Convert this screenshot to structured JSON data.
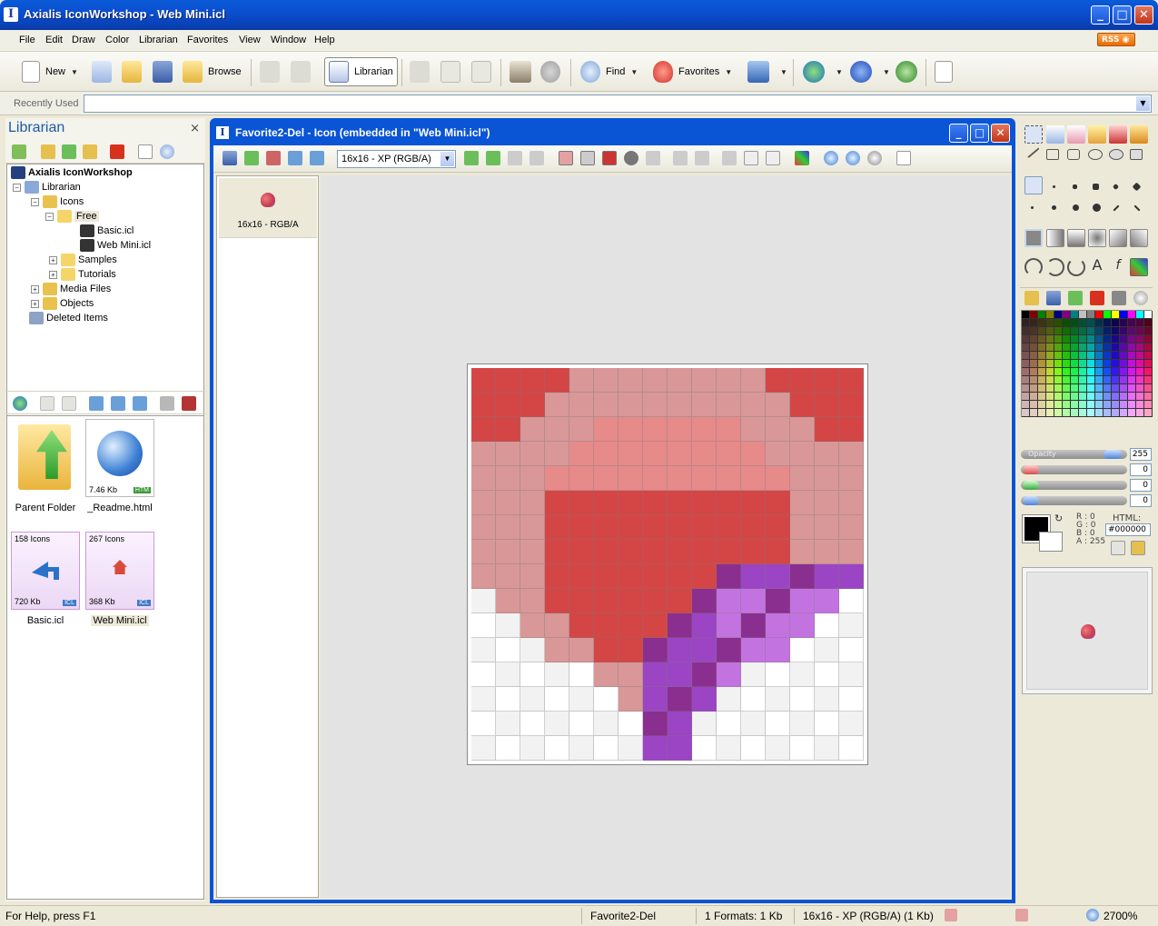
{
  "window": {
    "title": "Axialis IconWorkshop - Web Mini.icl",
    "minimize": "_",
    "maximize": "□",
    "close": "✕"
  },
  "menu": [
    "File",
    "Edit",
    "Draw",
    "Color",
    "Librarian",
    "Favorites",
    "View",
    "Window",
    "Help"
  ],
  "rss_label": "RSS",
  "toolbar": {
    "new_label": "New",
    "browse_label": "Browse",
    "librarian_label": "Librarian",
    "find_label": "Find",
    "favorites_label": "Favorites"
  },
  "recent": {
    "label": "Recently Used",
    "value": ""
  },
  "librarian": {
    "title": "Librarian",
    "close": "×",
    "tree": [
      {
        "label": "Axialis IconWorkshop",
        "level": 0
      },
      {
        "label": "Librarian",
        "level": 1
      },
      {
        "label": "Icons",
        "level": 2
      },
      {
        "label": "Free",
        "level": 3
      },
      {
        "label": "Basic.icl",
        "level": 4
      },
      {
        "label": "Web Mini.icl",
        "level": 4
      },
      {
        "label": "Samples",
        "level": 3
      },
      {
        "label": "Tutorials",
        "level": 3
      },
      {
        "label": "Media Files",
        "level": 2
      },
      {
        "label": "Objects",
        "level": 2
      },
      {
        "label": "Deleted Items",
        "level": 1
      }
    ],
    "files": [
      {
        "name": "Parent Folder"
      },
      {
        "name": "_Readme.html",
        "size": "7.46 Kb",
        "tag": "HTM"
      },
      {
        "name": "Basic.icl",
        "count": "158 Icons",
        "size": "720 Kb",
        "tag": "ICL"
      },
      {
        "name": "Web Mini.icl",
        "count": "267 Icons",
        "size": "368 Kb",
        "tag": "ICL"
      }
    ]
  },
  "document": {
    "title": "Favorite2-Del - Icon (embedded in \"Web Mini.icl\")",
    "format_select": "16x16 - XP (RGB/A)",
    "format_entry": "16x16 - RGB/A"
  },
  "colors": {
    "opacity_label": "Opacity",
    "opacity": "255",
    "r_val": "0",
    "g_val": "0",
    "b_val": "0",
    "rgba_r": "R : 0",
    "rgba_g": "G : 0",
    "rgba_b": "B : 0",
    "rgba_a": "A : 255",
    "html_label": "HTML:",
    "html_value": "#000000",
    "current": "#000000"
  },
  "status": {
    "help": "For Help, press F1",
    "name": "Favorite2-Del",
    "formats": "1 Formats: 1 Kb",
    "size": "16x16 - XP (RGB/A) (1 Kb)",
    "zoom": "2700%"
  }
}
